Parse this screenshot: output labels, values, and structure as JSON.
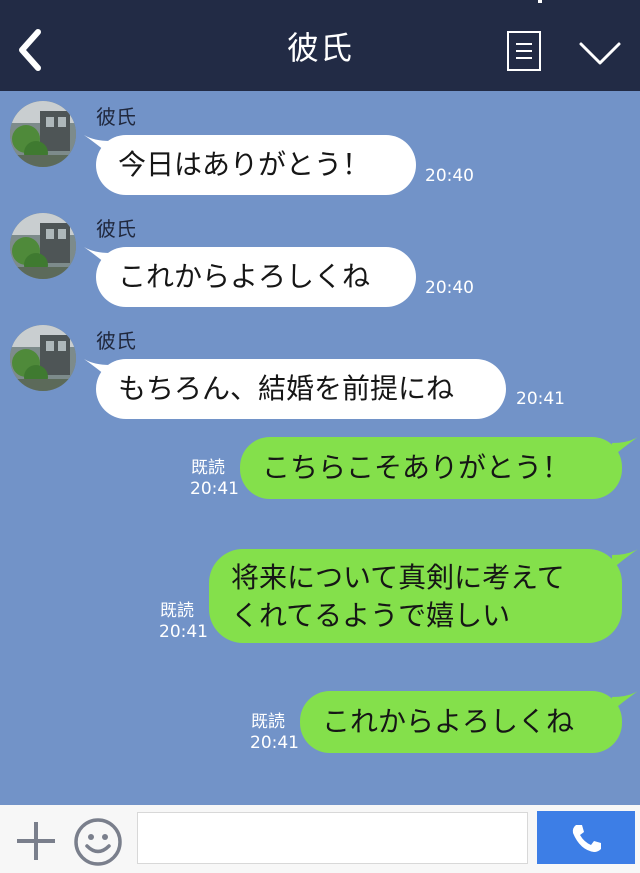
{
  "header": {
    "title": "彼氏"
  },
  "messages": [
    {
      "sender": "彼氏",
      "text": "今日はありがとう！",
      "time": "20:40"
    },
    {
      "sender": "彼氏",
      "text": "これからよろしくね",
      "time": "20:40"
    },
    {
      "sender": "彼氏",
      "text": "もちろん、結婚を前提にね",
      "time": "20:41"
    },
    {
      "read": "既読",
      "text": "こちらこそありがとう！",
      "time": "20:41"
    },
    {
      "read": "既読",
      "text_line1": "将来について真剣に考えて",
      "text_line2": "くれてるようで嬉しい",
      "time": "20:41"
    },
    {
      "read": "既読",
      "text": "これからよろしくね",
      "time": "20:41"
    }
  ],
  "footer": {
    "input_value": "",
    "input_placeholder": ""
  },
  "colors": {
    "header_bg": "#222b45",
    "chat_bg": "#7293c8",
    "incoming_bubble": "#ffffff",
    "outgoing_bubble": "#84e04b",
    "call_button": "#3d7ee6"
  },
  "icons": [
    "back-icon",
    "menu-icon",
    "chevron-down-icon",
    "plus-icon",
    "emoji-icon",
    "phone-icon"
  ]
}
